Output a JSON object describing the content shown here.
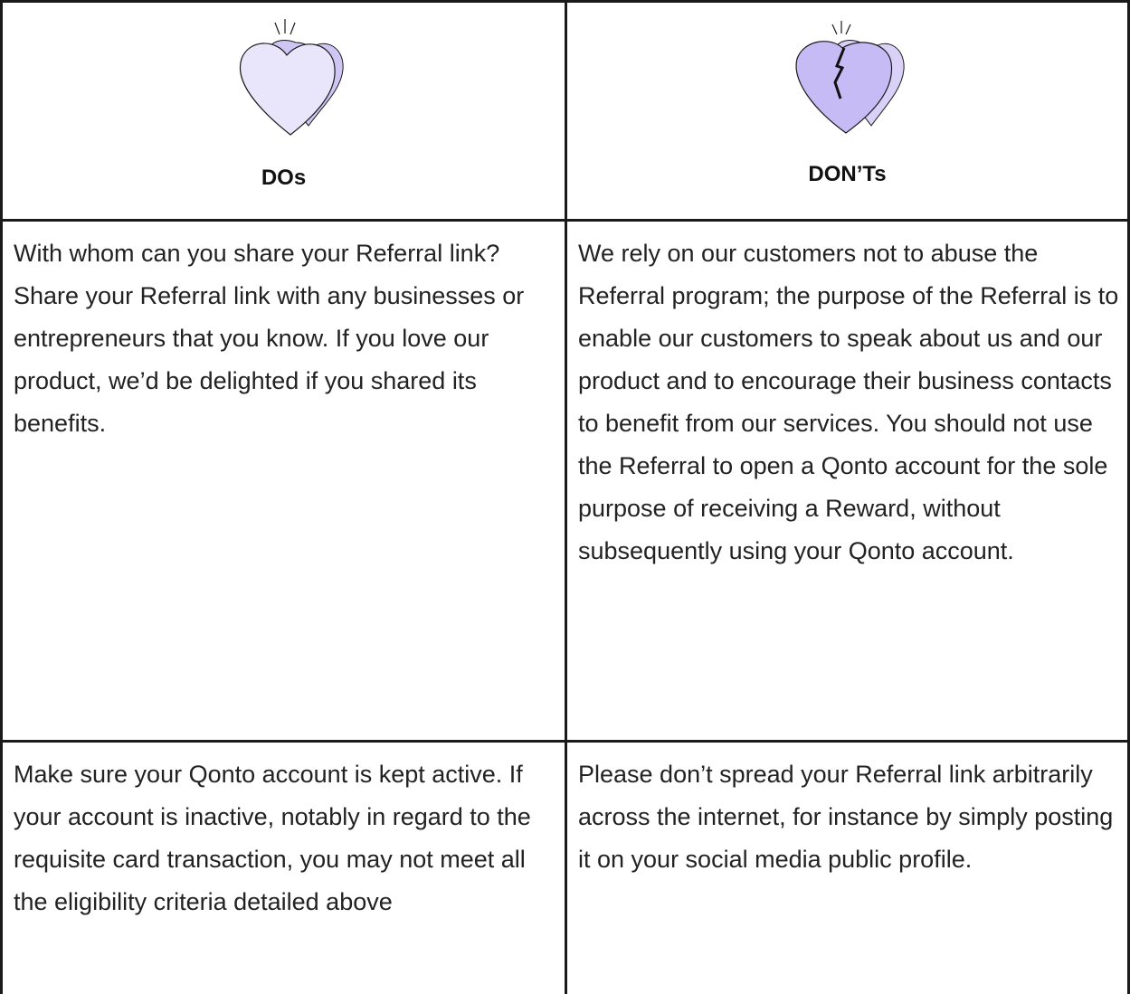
{
  "table": {
    "columns": [
      {
        "heading": "DOs",
        "icon": "heart-icon"
      },
      {
        "heading": "DON’Ts",
        "icon": "broken-heart-icon"
      }
    ],
    "rows": [
      {
        "dos": "With whom can you share your Referral link? Share your Referral link with any businesses or entrepreneurs that you know. If you love our product, we’d be delighted if you shared its benefits.",
        "donts": "We rely on our customers not to abuse the Referral program; the purpose of the Referral is to enable our customers to speak about us and our product and to encourage their business contacts to benefit from our services. You should not use the Referral to open a Qonto account for the sole purpose of receiving a Reward, without subsequently using your Qonto account."
      },
      {
        "dos": "Make sure your Qonto account is kept active. If your account is inactive, notably in regard to the requisite card transaction, you may not meet all the eligibility criteria detailed above",
        "donts": "Please don’t spread your Referral link arbitrarily across the internet, for instance by simply posting it on your social media public profile."
      }
    ]
  },
  "colors": {
    "heart_fill_front": "#e9e6fc",
    "heart_fill_back": "#cfc6f4",
    "broken_heart_fill_front": "#c6bbf5",
    "broken_heart_fill_back": "#d9d1f8",
    "stroke": "#1a1a1a"
  }
}
